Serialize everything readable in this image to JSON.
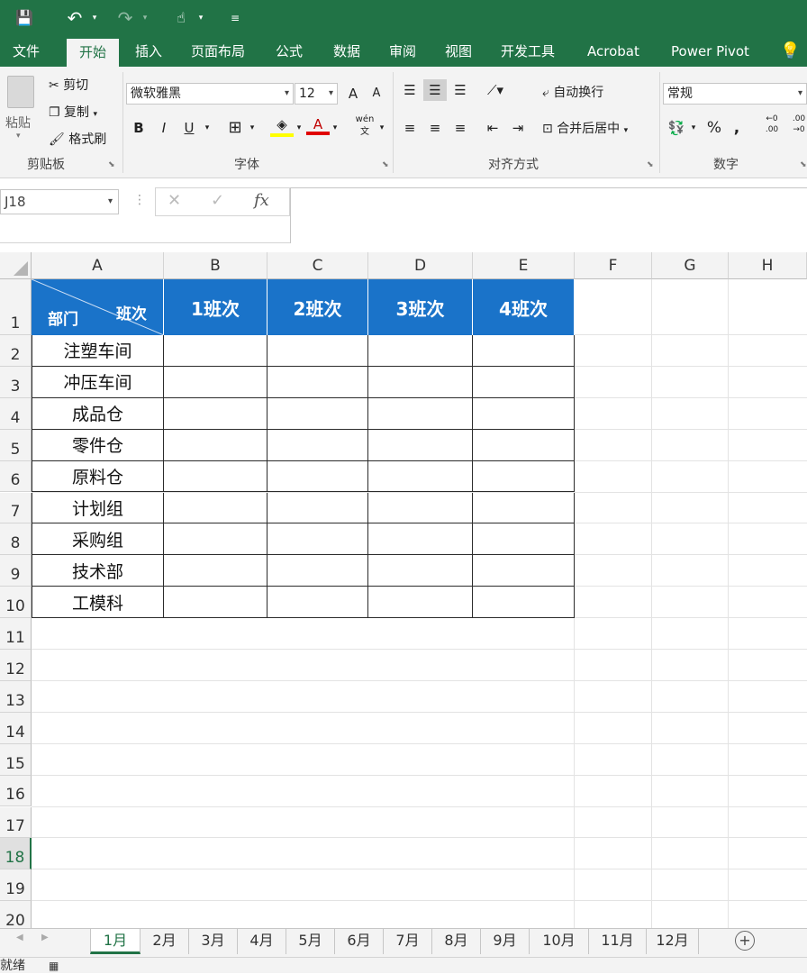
{
  "quick_access": {
    "save": "💾",
    "undo": "↶",
    "redo": "↷",
    "touch": "☝",
    "more": "≡"
  },
  "ribbon_tabs": [
    "文件",
    "开始",
    "插入",
    "页面布局",
    "公式",
    "数据",
    "审阅",
    "视图",
    "开发工具",
    "Acrobat",
    "Power Pivot"
  ],
  "active_tab": "开始",
  "clipboard": {
    "paste": "粘贴",
    "cut": "剪切",
    "copy": "复制",
    "format_painter": "格式刷",
    "group": "剪贴板"
  },
  "font": {
    "name": "微软雅黑",
    "size": "12",
    "bold": "B",
    "italic": "I",
    "underline": "U",
    "group": "字体",
    "grow": "A",
    "shrink": "A",
    "wen": "wén"
  },
  "alignment": {
    "wrap": "自动换行",
    "merge": "合并后居中",
    "group": "对齐方式"
  },
  "number": {
    "format": "常规",
    "percent": "%",
    "comma": ",",
    "group": "数字"
  },
  "namebox": "J18",
  "fx": "fx",
  "columns": [
    "A",
    "B",
    "C",
    "D",
    "E",
    "F",
    "G",
    "H"
  ],
  "rows": [
    "1",
    "2",
    "3",
    "4",
    "5",
    "6",
    "7",
    "8",
    "9",
    "10",
    "11",
    "12",
    "13",
    "14",
    "15",
    "16",
    "17",
    "18",
    "19",
    "20"
  ],
  "selected_row": "18",
  "table": {
    "corner_top": "班次",
    "corner_bottom": "部门",
    "headers": [
      "1班次",
      "2班次",
      "3班次",
      "4班次"
    ],
    "departments": [
      "注塑车间",
      "冲压车间",
      "成品仓",
      "零件仓",
      "原料仓",
      "计划组",
      "采购组",
      "技术部",
      "工模科"
    ]
  },
  "sheets": [
    "1月",
    "2月",
    "3月",
    "4月",
    "5月",
    "6月",
    "7月",
    "8月",
    "9月",
    "10月",
    "11月",
    "12月"
  ],
  "active_sheet": "1月",
  "status": "就绪",
  "colors": {
    "excel_green": "#217346",
    "header_blue": "#1a73c9"
  }
}
